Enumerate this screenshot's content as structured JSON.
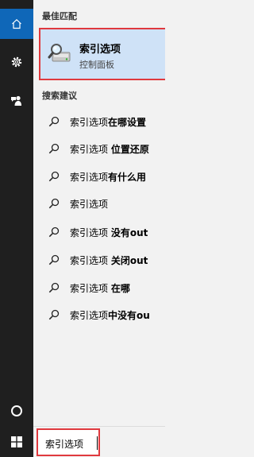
{
  "rail": {
    "home_icon": "home-icon",
    "settings_icon": "gear-icon",
    "feedback_icon": "feedback-icon",
    "cortana_icon": "cortana-circle-icon",
    "start_icon": "windows-logo-icon"
  },
  "best_match": {
    "header": "最佳匹配",
    "title": "索引选项",
    "subtitle": "控制面板",
    "icon": "indexing-options-icon"
  },
  "suggestions": {
    "header": "搜索建议",
    "items": [
      {
        "prefix": "索引选项",
        "bold": "在哪设置"
      },
      {
        "prefix": "索引选项 ",
        "bold": "位置还原"
      },
      {
        "prefix": "索引选项",
        "bold": "有什么用"
      },
      {
        "prefix": "索引选项",
        "bold": ""
      },
      {
        "prefix": "索引选项 ",
        "bold": "没有out"
      },
      {
        "prefix": "索引选项 ",
        "bold": "关闭out"
      },
      {
        "prefix": "索引选项 ",
        "bold": "在哪"
      },
      {
        "prefix": "索引选项",
        "bold": "中没有ou"
      }
    ]
  },
  "search": {
    "value": "索引选项"
  },
  "colors": {
    "rail_bg": "#1f1f1f",
    "home_active": "#0f67b8",
    "highlight": "#cfe2f7",
    "red_outline": "#e0393e"
  }
}
